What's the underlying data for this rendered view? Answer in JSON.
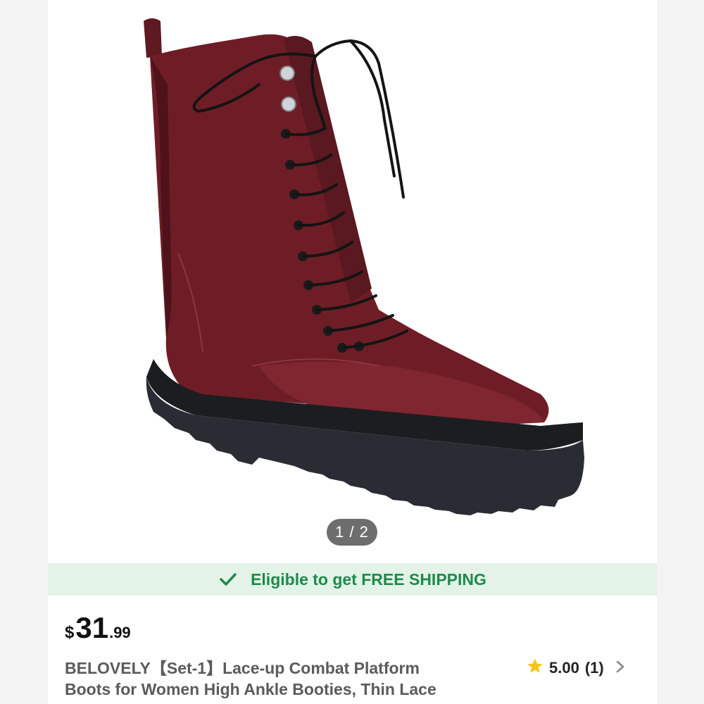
{
  "gallery": {
    "pager_text": "1 / 2",
    "product_image": "burgundy-combat-boot-icon"
  },
  "shipping": {
    "icon": "check-icon",
    "text": "Eligible to get FREE SHIPPING",
    "color": "#1f8a4c",
    "background": "#e3f3e7"
  },
  "price": {
    "currency": "$",
    "integer": "31",
    "decimal": ".99"
  },
  "product": {
    "title_line1": "BELOVELY【Set-1】Lace-up Combat Platform",
    "title_line2": "Boots for Women High Ankle Booties, Thin Lace"
  },
  "rating": {
    "icon": "star-icon",
    "value": "5.00",
    "count": "(1)",
    "chevron": "chevron-right-icon"
  }
}
